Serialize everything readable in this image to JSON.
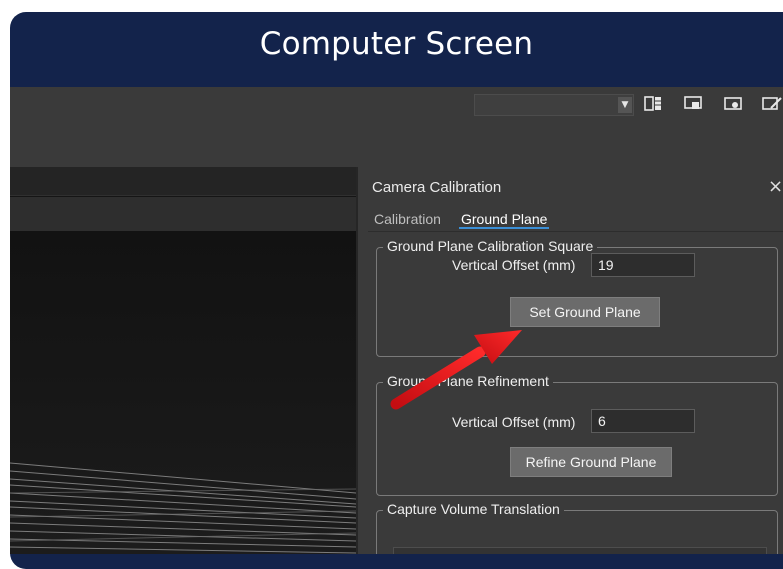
{
  "frame": {
    "title": "Computer Screen"
  },
  "toolbar": {
    "combo_value": "",
    "icons": [
      "layout-icon",
      "screen-icon",
      "camera-icon",
      "edit-icon"
    ]
  },
  "panel": {
    "title": "Camera Calibration",
    "close_label": "×",
    "tabs": [
      {
        "label": "Calibration",
        "active": false
      },
      {
        "label": "Ground Plane",
        "active": true
      }
    ],
    "groups": [
      {
        "legend": "Ground Plane Calibration Square",
        "field_label": "Vertical Offset (mm)",
        "field_value": "19",
        "button_label": "Set Ground Plane"
      },
      {
        "legend": "Ground Plane Refinement",
        "field_label": "Vertical Offset (mm)",
        "field_value": "6",
        "button_label": "Refine Ground Plane"
      },
      {
        "legend": "Capture Volume Translation"
      }
    ]
  },
  "colors": {
    "bezel": "#13234b",
    "panel_bg": "#3a3a3a",
    "button_bg": "#6b6b6b",
    "tab_accent": "#3b8fd6",
    "arrow": "#e8141a"
  }
}
